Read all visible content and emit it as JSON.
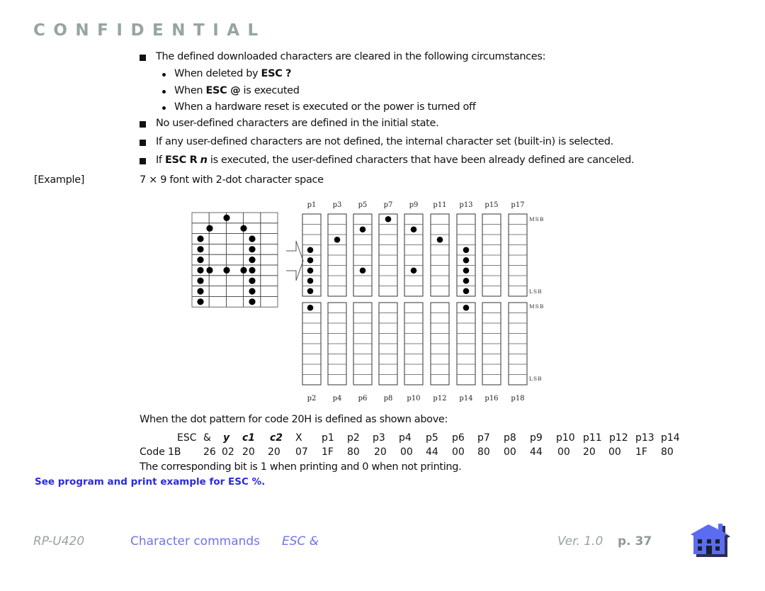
{
  "header": {
    "watermark": "CONFIDENTIAL"
  },
  "body": {
    "bullets": [
      {
        "type": "square",
        "text": "The defined downloaded characters are cleared in the following circumstances:"
      },
      {
        "type": "dot",
        "pre": "When deleted by ",
        "cmd": "ESC ?",
        "post": ""
      },
      {
        "type": "dot",
        "pre": "When ",
        "cmd": "ESC @",
        "post": " is executed"
      },
      {
        "type": "dot",
        "pre": "When a hardware reset is executed or the power is turned off",
        "cmd": "",
        "post": ""
      },
      {
        "type": "square",
        "text": "No user-defined characters are defined in the initial state."
      },
      {
        "type": "square",
        "text": "If any user-defined characters are not defined, the internal character set (built-in) is selected."
      },
      {
        "type": "square",
        "pre": "If ",
        "cmd": "ESC R",
        "param": "n",
        "post": " is executed, the user-defined characters that have been already defined are canceled."
      }
    ],
    "example_label": "[Example]",
    "example_text": "7 × 9 font with 2-dot character space",
    "pattern_intro": "When the dot pattern for code 20H is defined as shown above:",
    "code_table": {
      "header": [
        "ESC",
        "&",
        "y",
        "c1",
        "c2",
        "X",
        "p1",
        "p2",
        "p3",
        "p4",
        "p5",
        "p6",
        "p7",
        "p8",
        "p9",
        "p10",
        "p11",
        "p12",
        "p13",
        "p14"
      ],
      "row_label": "Code",
      "values": [
        "1B",
        "26",
        "02",
        "20",
        "20",
        "07",
        "1F",
        "80",
        "20",
        "00",
        "44",
        "00",
        "80",
        "00",
        "44",
        "00",
        "20",
        "00",
        "1F",
        "80"
      ]
    },
    "bit_note": "The corresponding bit is 1 when printing and 0 when not printing.",
    "see_link": {
      "pre": "See program and print example for ",
      "cmd": "ESC %",
      "post": "."
    }
  },
  "figure": {
    "char_grid": {
      "cols": 5,
      "rows": 9,
      "dots": [
        [
          0,
          3
        ],
        [
          1,
          2
        ],
        [
          1,
          4
        ],
        [
          2,
          1
        ],
        [
          2,
          5
        ],
        [
          3,
          1
        ],
        [
          3,
          5
        ],
        [
          4,
          1
        ],
        [
          4,
          5
        ],
        [
          5,
          1
        ],
        [
          5,
          2
        ],
        [
          5,
          3
        ],
        [
          5,
          4
        ],
        [
          5,
          5
        ],
        [
          6,
          1
        ],
        [
          6,
          5
        ],
        [
          7,
          1
        ],
        [
          7,
          5
        ],
        [
          8,
          1
        ],
        [
          8,
          5
        ]
      ]
    },
    "top_labels": [
      "p1",
      "p3",
      "p5",
      "p7",
      "p9",
      "p11",
      "p13",
      "p15",
      "p17"
    ],
    "bottom_labels": [
      "p2",
      "p4",
      "p6",
      "p8",
      "p10",
      "p12",
      "p14",
      "p16",
      "p18"
    ],
    "msb_label": "MSB",
    "lsb_label": "LSB",
    "top_dots": [
      [
        3,
        4,
        5,
        6,
        7
      ],
      [
        2
      ],
      [
        1,
        5
      ],
      [
        0
      ],
      [
        1,
        5
      ],
      [
        2
      ],
      [
        3,
        4,
        5,
        6,
        7
      ],
      [],
      []
    ],
    "bottom_dots": [
      [
        0
      ],
      [],
      [],
      [],
      [],
      [],
      [
        0
      ],
      [],
      []
    ]
  },
  "footer": {
    "model": "RP-U420",
    "section": "Character commands",
    "command": "ESC &",
    "version": "Ver. 1.0",
    "page": "p. 37",
    "home_icon_color": "#5b6cf0"
  }
}
